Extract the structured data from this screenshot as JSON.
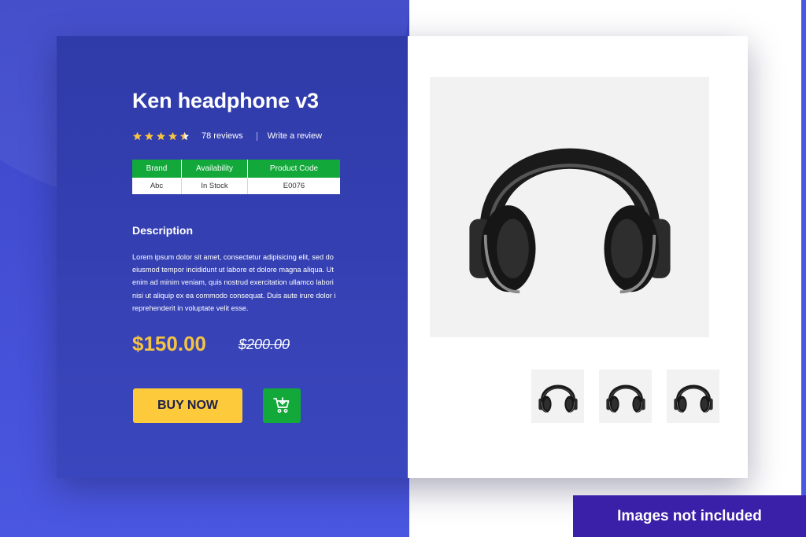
{
  "product": {
    "title": "Ken headphone v3",
    "rating": 4.5,
    "rating_max": 5,
    "reviews_label": "78 reviews",
    "write_review_label": "Write a review",
    "specs": {
      "headers": [
        "Brand",
        "Availability",
        "Product Code"
      ],
      "values": [
        "Abc",
        "In Stock",
        "E0076"
      ]
    },
    "description_title": "Description",
    "description": "Lorem ipsum dolor sit amet, consectetur adipisicing elit, sed do eiusmod tempor incididunt ut labore et dolore magna aliqua. Ut enim ad minim veniam, quis nostrud exercitation ullamco labori nisi ut aliquip ex ea commodo consequat. Duis aute irure dolor i reprehenderit in voluptate velit esse.",
    "price": "$150.00",
    "old_price": "$200.00",
    "buy_label": "BUY NOW"
  },
  "gallery": {
    "main_image_icon": "headphones-icon",
    "thumbnails": [
      "headphones-icon",
      "headphones-icon",
      "headphones-icon"
    ]
  },
  "notice": "Images not included",
  "colors": {
    "primary_blue": "#3a46bd",
    "accent_green": "#12a83a",
    "accent_yellow": "#fcca3a",
    "price_yellow": "#f5c342",
    "notice_purple": "#3a1fa8"
  }
}
